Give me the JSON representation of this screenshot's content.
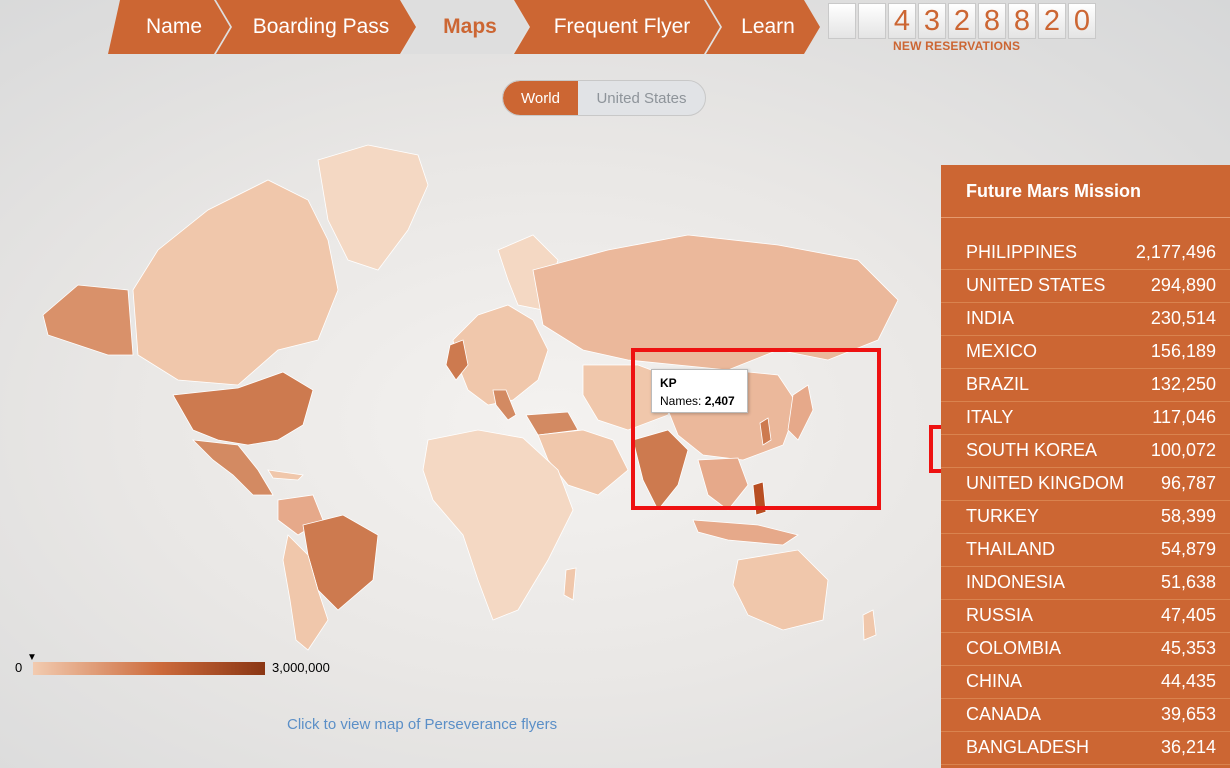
{
  "nav": {
    "items": [
      {
        "label": "Name"
      },
      {
        "label": "Boarding Pass"
      },
      {
        "label": "Maps"
      },
      {
        "label": "Frequent Flyer"
      },
      {
        "label": "Learn"
      }
    ],
    "active": "Maps"
  },
  "counter": {
    "digits": [
      "",
      "",
      "4",
      "3",
      "2",
      "8",
      "8",
      "2",
      "0"
    ],
    "label": "NEW RESERVATIONS"
  },
  "toggle": {
    "world": "World",
    "us": "United States",
    "selected": "World"
  },
  "map": {
    "tooltip": {
      "code": "KP",
      "names_label": "Names:",
      "names_value": "2,407"
    },
    "legend": {
      "min": "0",
      "max": "3,000,000"
    },
    "link": "Click to view map of Perseverance flyers",
    "colors": {
      "light": "#f4d8c3",
      "medium": "#e6a98a",
      "dark": "#cd7a4f",
      "darkest": "#b84e22"
    }
  },
  "panel": {
    "title": "Future Mars Mission",
    "rows": [
      {
        "country": "PHILIPPINES",
        "count": "2,177,496"
      },
      {
        "country": "UNITED STATES",
        "count": "294,890"
      },
      {
        "country": "INDIA",
        "count": "230,514"
      },
      {
        "country": "MEXICO",
        "count": "156,189"
      },
      {
        "country": "BRAZIL",
        "count": "132,250"
      },
      {
        "country": "ITALY",
        "count": "117,046"
      },
      {
        "country": "SOUTH KOREA",
        "count": "100,072"
      },
      {
        "country": "UNITED KINGDOM",
        "count": "96,787"
      },
      {
        "country": "TURKEY",
        "count": "58,399"
      },
      {
        "country": "THAILAND",
        "count": "54,879"
      },
      {
        "country": "INDONESIA",
        "count": "51,638"
      },
      {
        "country": "RUSSIA",
        "count": "47,405"
      },
      {
        "country": "COLOMBIA",
        "count": "45,353"
      },
      {
        "country": "CHINA",
        "count": "44,435"
      },
      {
        "country": "CANADA",
        "count": "39,653"
      },
      {
        "country": "BANGLADESH",
        "count": "36,214"
      }
    ]
  },
  "theme": {
    "accent": "#cc6633",
    "highlight": "#ee1111"
  }
}
